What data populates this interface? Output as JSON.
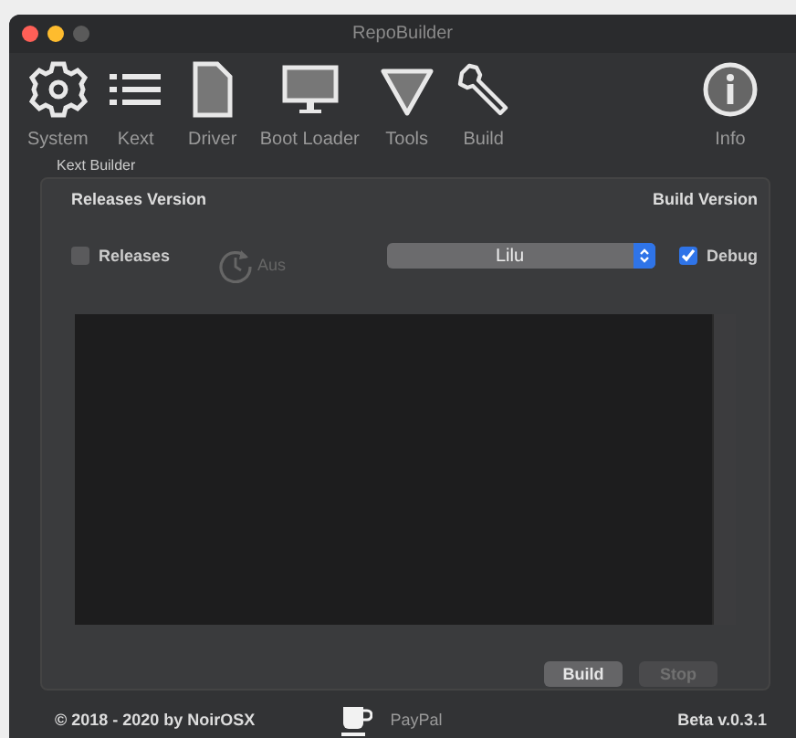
{
  "window": {
    "title": "RepoBuilder"
  },
  "toolbar": [
    {
      "kind": "gear",
      "label": "System"
    },
    {
      "kind": "list",
      "label": "Kext"
    },
    {
      "kind": "document",
      "label": "Driver"
    },
    {
      "kind": "monitor",
      "label": "Boot Loader"
    },
    {
      "kind": "triangle",
      "label": "Tools"
    },
    {
      "kind": "wrench",
      "label": "Build"
    },
    {
      "kind": "info",
      "label": "Info"
    }
  ],
  "group": {
    "title": "Kext Builder",
    "left_heading": "Releases Version",
    "right_heading": "Build Version",
    "releases": {
      "label": "Releases",
      "checked": false
    },
    "auto": {
      "label": "Aus",
      "disabled": true
    },
    "dropdown": {
      "value": "Lilu"
    },
    "debug": {
      "label": "Debug",
      "checked": true
    },
    "buttons": [
      {
        "label": "Build",
        "disabled": false
      },
      {
        "label": "Stop",
        "disabled": true
      }
    ]
  },
  "footer": {
    "copyright": "© 2018 - 2020 by NoirOSX",
    "paypal": "PayPal",
    "version": "Beta v.0.3.1"
  }
}
